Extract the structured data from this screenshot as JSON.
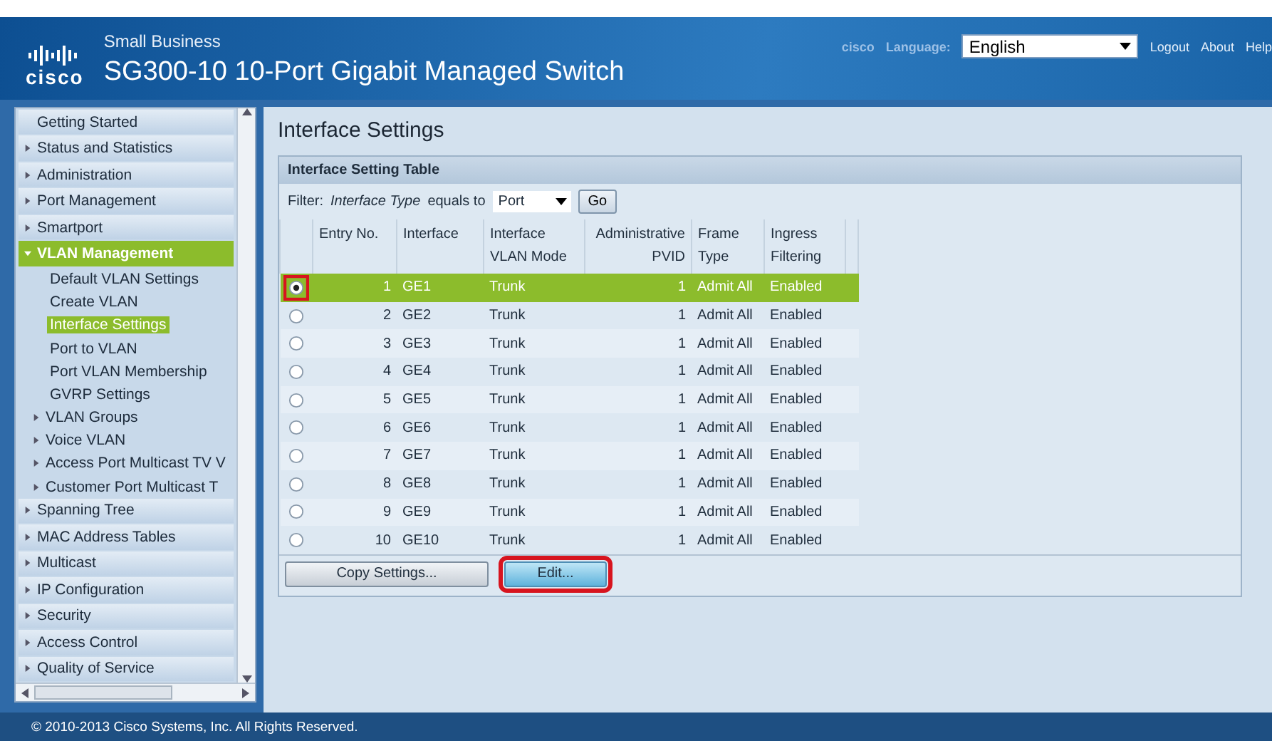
{
  "header": {
    "brand": "cisco",
    "subtitle": "Small Business",
    "title": "SG300-10 10-Port Gigabit Managed Switch",
    "user": "cisco",
    "language_label": "Language:",
    "language": "English",
    "links": [
      "Logout",
      "About",
      "Help"
    ]
  },
  "sidebar": {
    "items": [
      {
        "label": "Getting Started",
        "kind": "page",
        "selected": false
      },
      {
        "label": "Status and Statistics",
        "kind": "folder",
        "expanded": false
      },
      {
        "label": "Administration",
        "kind": "folder",
        "expanded": false
      },
      {
        "label": "Port Management",
        "kind": "folder",
        "expanded": false
      },
      {
        "label": "Smartport",
        "kind": "folder",
        "expanded": false
      },
      {
        "label": "VLAN Management",
        "kind": "folder",
        "expanded": true,
        "children": [
          {
            "label": "Default VLAN Settings",
            "kind": "page",
            "selected": false
          },
          {
            "label": "Create VLAN",
            "kind": "page",
            "selected": false
          },
          {
            "label": "Interface Settings",
            "kind": "page",
            "selected": true
          },
          {
            "label": "Port to VLAN",
            "kind": "page",
            "selected": false
          },
          {
            "label": "Port VLAN Membership",
            "kind": "page",
            "selected": false
          },
          {
            "label": "GVRP Settings",
            "kind": "page",
            "selected": false
          },
          {
            "label": "VLAN Groups",
            "kind": "folder",
            "expanded": false
          },
          {
            "label": "Voice VLAN",
            "kind": "folder",
            "expanded": false
          },
          {
            "label": "Access Port Multicast TV V",
            "kind": "folder",
            "expanded": false
          },
          {
            "label": "Customer Port Multicast T",
            "kind": "folder",
            "expanded": false
          }
        ]
      },
      {
        "label": "Spanning Tree",
        "kind": "folder",
        "expanded": false
      },
      {
        "label": "MAC Address Tables",
        "kind": "folder",
        "expanded": false
      },
      {
        "label": "Multicast",
        "kind": "folder",
        "expanded": false
      },
      {
        "label": "IP Configuration",
        "kind": "folder",
        "expanded": false
      },
      {
        "label": "Security",
        "kind": "folder",
        "expanded": false
      },
      {
        "label": "Access Control",
        "kind": "folder",
        "expanded": false
      },
      {
        "label": "Quality of Service",
        "kind": "folder",
        "expanded": false
      }
    ]
  },
  "page": {
    "title": "Interface Settings",
    "panel_title": "Interface Setting Table",
    "filter": {
      "label": "Filter:",
      "field": "Interface Type",
      "operator": "equals to",
      "value": "Port",
      "button": "Go"
    },
    "table": {
      "columns": [
        "Entry No.",
        "Interface",
        "Interface VLAN Mode",
        "Administrative PVID",
        "Frame Type",
        "Ingress Filtering"
      ],
      "rows": [
        {
          "selected": true,
          "highlighted": true,
          "cells": [
            "1",
            "GE1",
            "Trunk",
            "1",
            "Admit All",
            "Enabled"
          ]
        },
        {
          "selected": false,
          "highlighted": false,
          "cells": [
            "2",
            "GE2",
            "Trunk",
            "1",
            "Admit All",
            "Enabled"
          ]
        },
        {
          "selected": false,
          "highlighted": false,
          "cells": [
            "3",
            "GE3",
            "Trunk",
            "1",
            "Admit All",
            "Enabled"
          ]
        },
        {
          "selected": false,
          "highlighted": false,
          "cells": [
            "4",
            "GE4",
            "Trunk",
            "1",
            "Admit All",
            "Enabled"
          ]
        },
        {
          "selected": false,
          "highlighted": false,
          "cells": [
            "5",
            "GE5",
            "Trunk",
            "1",
            "Admit All",
            "Enabled"
          ]
        },
        {
          "selected": false,
          "highlighted": false,
          "cells": [
            "6",
            "GE6",
            "Trunk",
            "1",
            "Admit All",
            "Enabled"
          ]
        },
        {
          "selected": false,
          "highlighted": false,
          "cells": [
            "7",
            "GE7",
            "Trunk",
            "1",
            "Admit All",
            "Enabled"
          ]
        },
        {
          "selected": false,
          "highlighted": false,
          "cells": [
            "8",
            "GE8",
            "Trunk",
            "1",
            "Admit All",
            "Enabled"
          ]
        },
        {
          "selected": false,
          "highlighted": false,
          "cells": [
            "9",
            "GE9",
            "Trunk",
            "1",
            "Admit All",
            "Enabled"
          ]
        },
        {
          "selected": false,
          "highlighted": false,
          "cells": [
            "10",
            "GE10",
            "Trunk",
            "1",
            "Admit All",
            "Enabled"
          ]
        }
      ]
    },
    "buttons": [
      {
        "label": "Copy Settings...",
        "kind": "plain",
        "highlighted": false
      },
      {
        "label": "Edit...",
        "kind": "primary",
        "highlighted": true
      }
    ]
  },
  "footer": "© 2010-2013 Cisco Systems, Inc. All Rights Reserved."
}
